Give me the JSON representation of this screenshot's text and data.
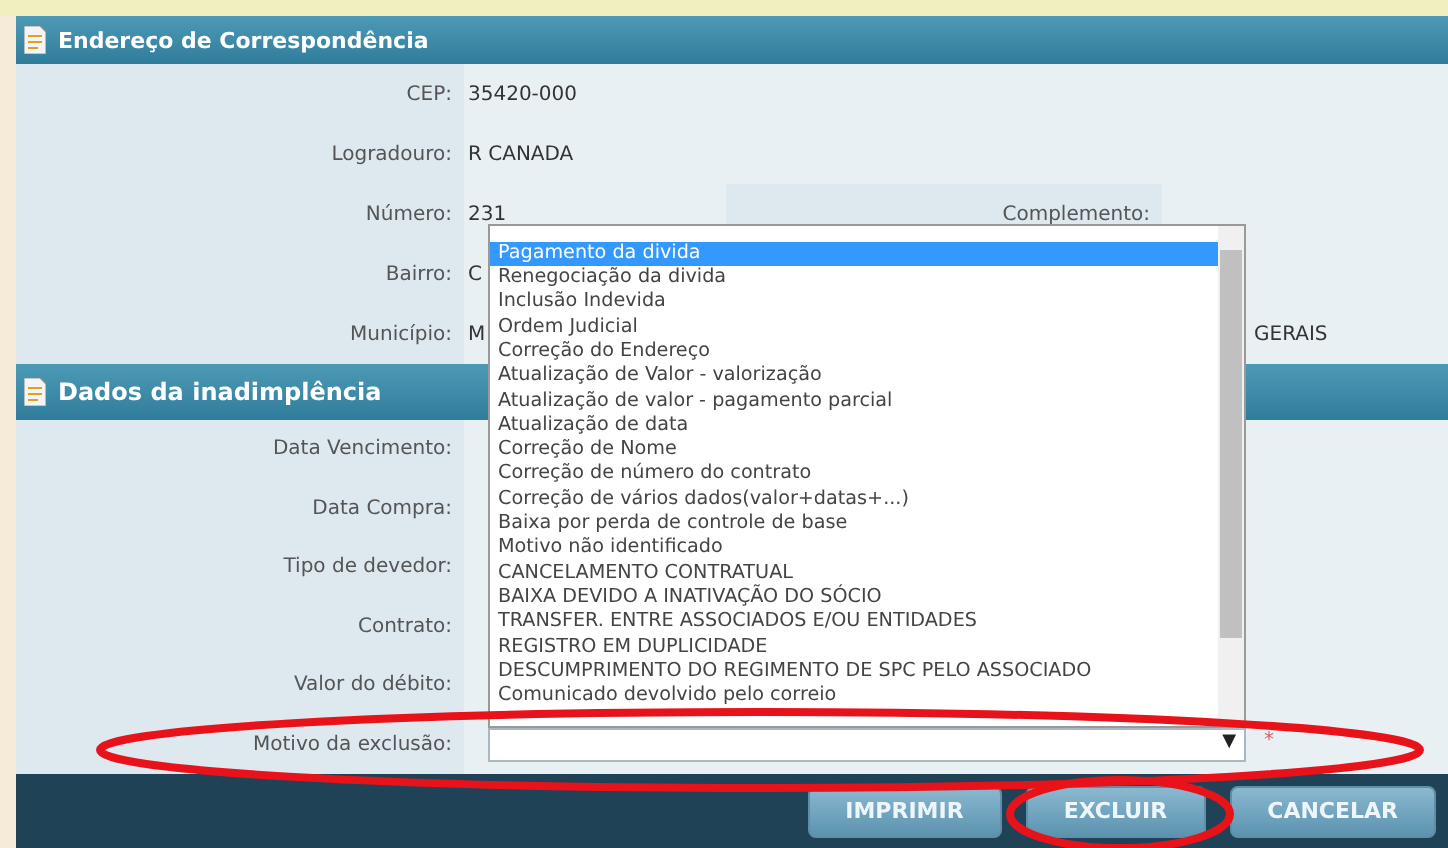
{
  "sections": [
    {
      "title": "Endereço de Correspondência",
      "fields": [
        {
          "label": "CEP:",
          "value": "35420-000"
        },
        {
          "label": "Logradouro:",
          "value": "R CANADA"
        },
        {
          "label": "Número:",
          "value": "231",
          "extra_label": "Complemento:"
        },
        {
          "label": "Bairro:",
          "value": "C"
        },
        {
          "label": "Município:",
          "value": "M",
          "extra_value": "GERAIS"
        }
      ]
    },
    {
      "title": "Dados da inadimplência",
      "fields": [
        {
          "label": "Data Vencimento:"
        },
        {
          "label": "Data Compra:"
        },
        {
          "label": "Tipo de devedor:"
        },
        {
          "label": "Contrato:"
        },
        {
          "label": "Valor do débito:"
        },
        {
          "label": "Motivo da exclusão:",
          "kind": "select",
          "arrow": "▼",
          "required_mark": "*"
        }
      ]
    }
  ],
  "dropdown": {
    "options": [
      {
        "label": "Pagamento da divida",
        "selected": true
      },
      {
        "label": "Renegociação da divida",
        "selected": false
      },
      {
        "label": "Inclusão Indevida",
        "selected": false
      },
      {
        "label": "Ordem Judicial",
        "selected": false
      },
      {
        "label": "Correção do Endereço",
        "selected": false
      },
      {
        "label": "Atualização de Valor - valorização",
        "selected": false
      },
      {
        "label": "Atualização de valor - pagamento parcial",
        "selected": false
      },
      {
        "label": "Atualização de data",
        "selected": false
      },
      {
        "label": "Correção de Nome",
        "selected": false
      },
      {
        "label": "Correção de número do contrato",
        "selected": false
      },
      {
        "label": "Correção de vários dados(valor+datas+...)",
        "selected": false
      },
      {
        "label": "Baixa por perda de controle de base",
        "selected": false
      },
      {
        "label": "Motivo não identificado",
        "selected": false
      },
      {
        "label": "CANCELAMENTO CONTRATUAL",
        "selected": false
      },
      {
        "label": "BAIXA DEVIDO A INATIVAÇÃO DO SÓCIO",
        "selected": false
      },
      {
        "label": "TRANSFER. ENTRE ASSOCIADOS E/OU ENTIDADES",
        "selected": false
      },
      {
        "label": "REGISTRO EM DUPLICIDADE",
        "selected": false
      },
      {
        "label": "DESCUMPRIMENTO DO REGIMENTO DE SPC PELO ASSOCIADO",
        "selected": false
      },
      {
        "label": "Comunicado devolvido pelo correio",
        "selected": false
      }
    ]
  },
  "buttons": [
    "IMPRIMIR",
    "EXCLUIR",
    "CANCELAR"
  ]
}
